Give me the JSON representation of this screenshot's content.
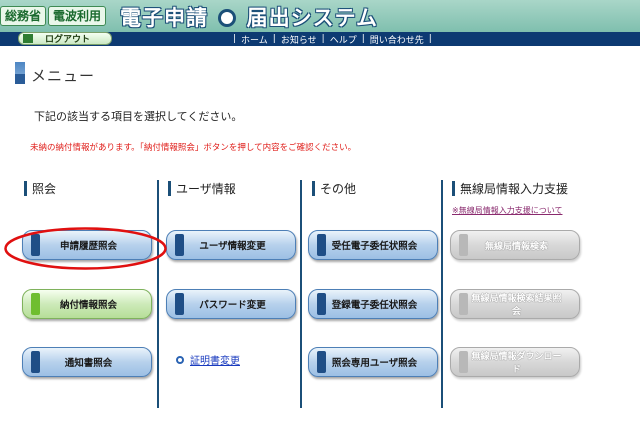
{
  "header": {
    "tag1": "総務省",
    "tag2": "電波利用",
    "system_title_part1": "電子申請",
    "system_title_part2": "届出システム"
  },
  "nav": {
    "logout_label": "ログアウト",
    "links": [
      "ホーム",
      "お知らせ",
      "ヘルプ",
      "問い合わせ先"
    ]
  },
  "menu": {
    "heading": "メニュー",
    "instruction": "下記の該当する項目を選択してください。",
    "warning": "未納の納付情報があります。「納付情報照会」ボタンを押して内容をご確認ください。"
  },
  "columns": [
    {
      "title": "照会",
      "buttons": [
        "申請履歴照会",
        "納付情報照会",
        "通知書照会"
      ]
    },
    {
      "title": "ユーザ情報",
      "buttons": [
        "ユーザ情報変更",
        "パスワード変更"
      ],
      "link": "証明書変更"
    },
    {
      "title": "その他",
      "buttons": [
        "受任電子委任状照会",
        "登録電子委任状照会",
        "照会専用ユーザ照会"
      ]
    },
    {
      "title": "無線局情報入力支援",
      "support_link": "※無線局情報入力支援について",
      "buttons": [
        "無線局情報検索",
        "無線局情報検索結果照会",
        "無線局情報ダウンロード"
      ]
    }
  ],
  "colors": {
    "navy": "#0d3a72",
    "warning_red": "#e0201c",
    "highlight_ellipse": "#e01010"
  }
}
